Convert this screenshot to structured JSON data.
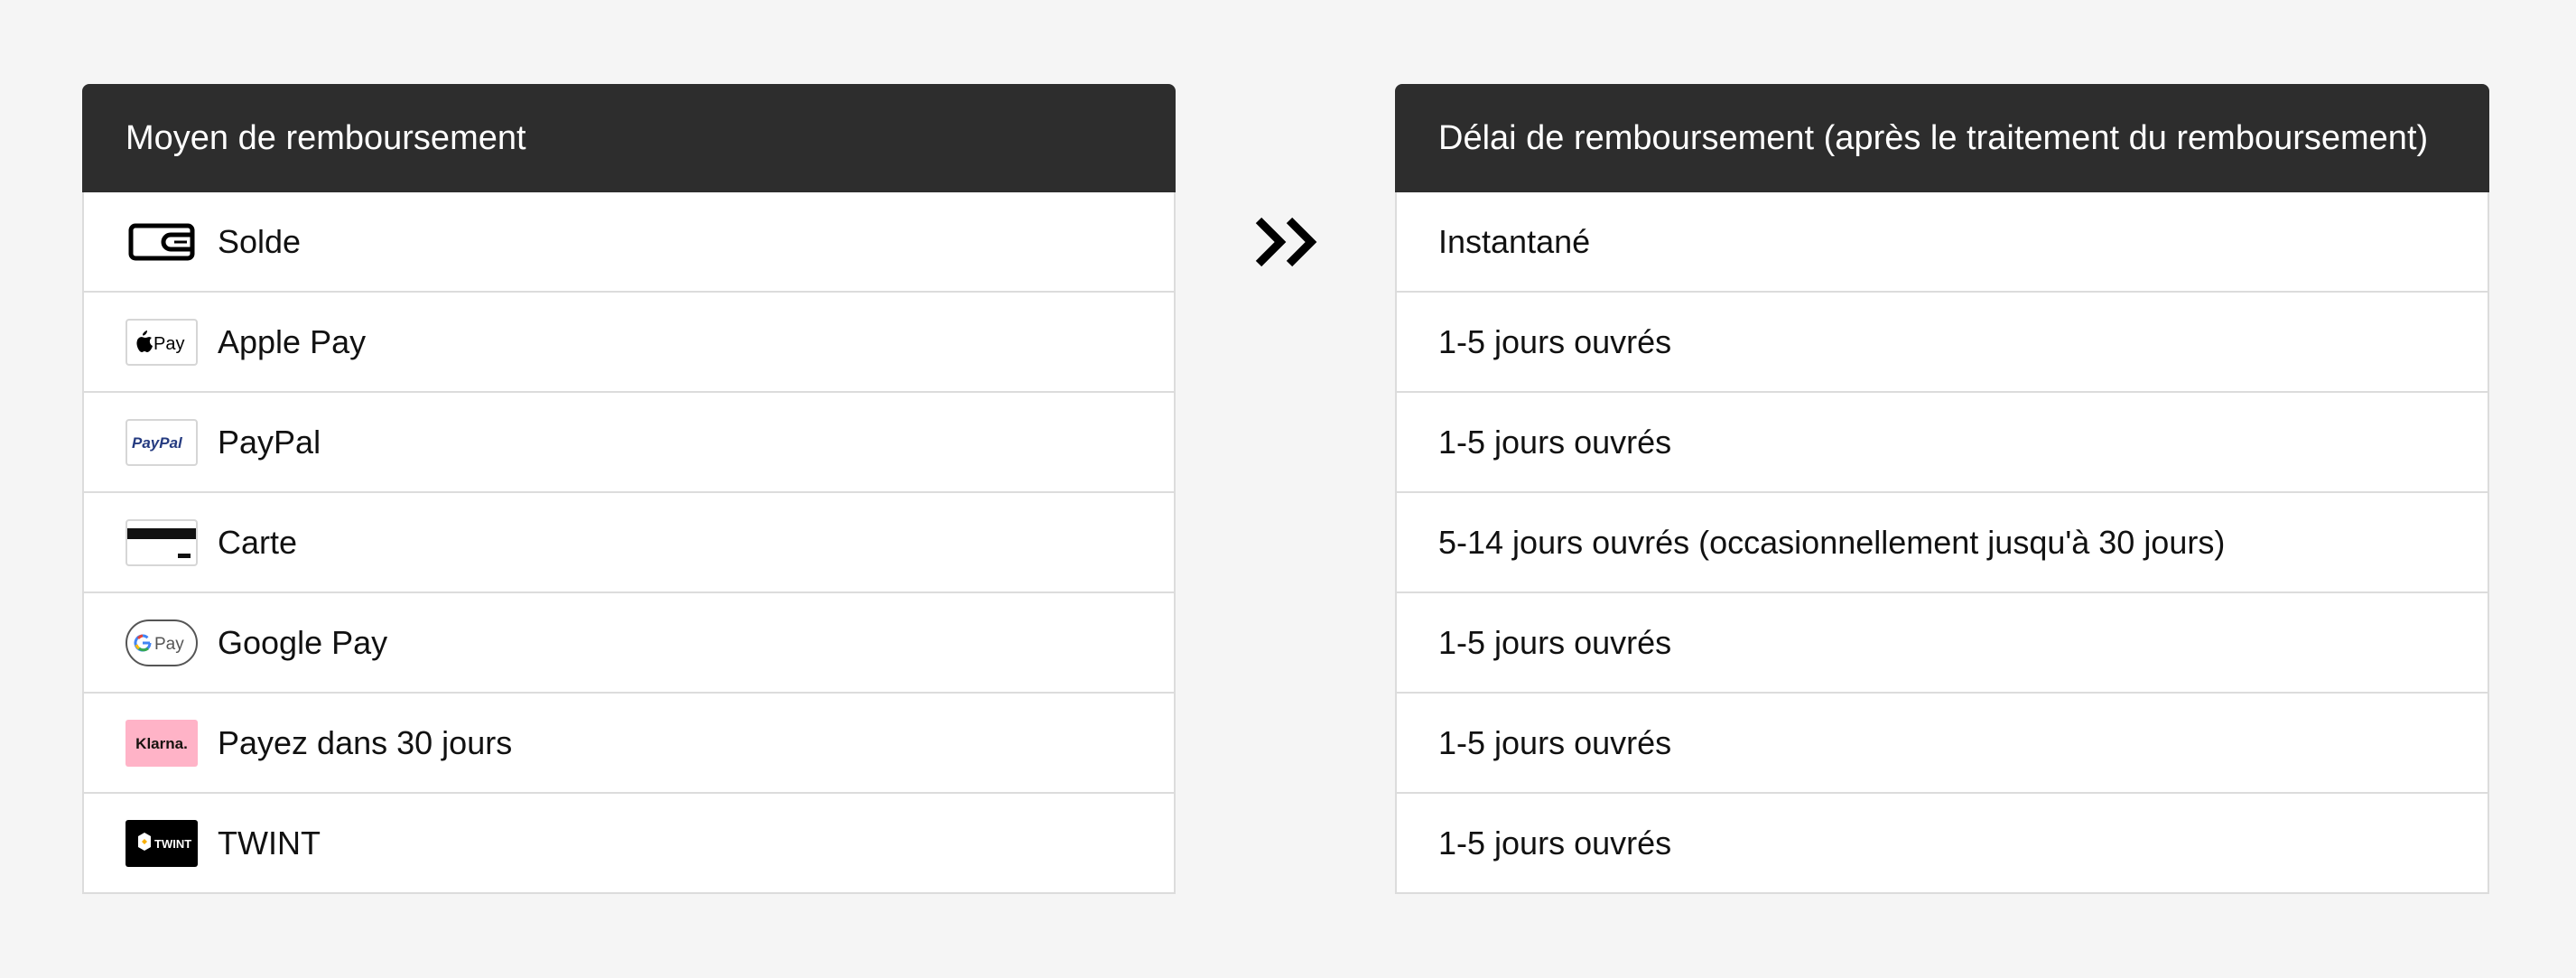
{
  "left_table": {
    "header": "Moyen de remboursement",
    "rows": [
      {
        "label": "Solde",
        "icon": "wallet-icon"
      },
      {
        "label": "Apple Pay",
        "icon": "apple-pay-icon"
      },
      {
        "label": "PayPal",
        "icon": "paypal-icon"
      },
      {
        "label": "Carte",
        "icon": "card-icon"
      },
      {
        "label": "Google Pay",
        "icon": "google-pay-icon"
      },
      {
        "label": "Payez dans 30 jours",
        "icon": "klarna-icon"
      },
      {
        "label": "TWINT",
        "icon": "twint-icon"
      }
    ]
  },
  "right_table": {
    "header": "Délai de remboursement (après le traitement du remboursement)",
    "rows": [
      "Instantané",
      "1-5 jours ouvrés",
      "1-5 jours ouvrés",
      "5-14 jours ouvrés (occasionnellement jusqu'à 30 jours)",
      "1-5 jours ouvrés",
      "1-5 jours ouvrés",
      "1-5 jours ouvrés"
    ]
  },
  "logos": {
    "apple_pay": "Pay",
    "paypal": "PayPal",
    "google_pay": "Pay",
    "klarna": "Klarna.",
    "twint": "TWINT"
  },
  "colors": {
    "header_bg": "#2d2d2d",
    "klarna_pink": "#ffb3c7",
    "paypal_dark": "#253b80",
    "paypal_light": "#179bd7"
  }
}
